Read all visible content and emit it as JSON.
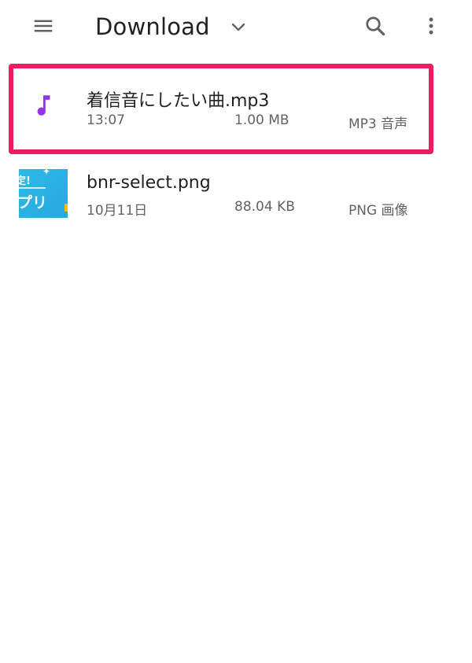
{
  "toolbar": {
    "title": "Download",
    "menu_icon": "menu-icon",
    "dropdown_icon": "chevron-down-icon",
    "search_icon": "search-icon",
    "more_icon": "more-vert-icon"
  },
  "files": [
    {
      "name": "着信音にしたい曲.mp3",
      "date": "13:07",
      "size": "1.00 MB",
      "type": "MP3 音声",
      "icon": "music-note-icon",
      "highlighted": true
    },
    {
      "name": "bnr-select.png",
      "date": "10月11日",
      "size": "88.04 KB",
      "type": "PNG 画像",
      "icon": "image-thumbnail",
      "thumb_text_top": "定!",
      "thumb_text_bottom": "プリ",
      "highlighted": false
    }
  ],
  "colors": {
    "highlight": "#ee1a62",
    "music_icon": "#9334e6",
    "icon_gray": "#5f6368",
    "thumb_blue": "#29acdf"
  }
}
